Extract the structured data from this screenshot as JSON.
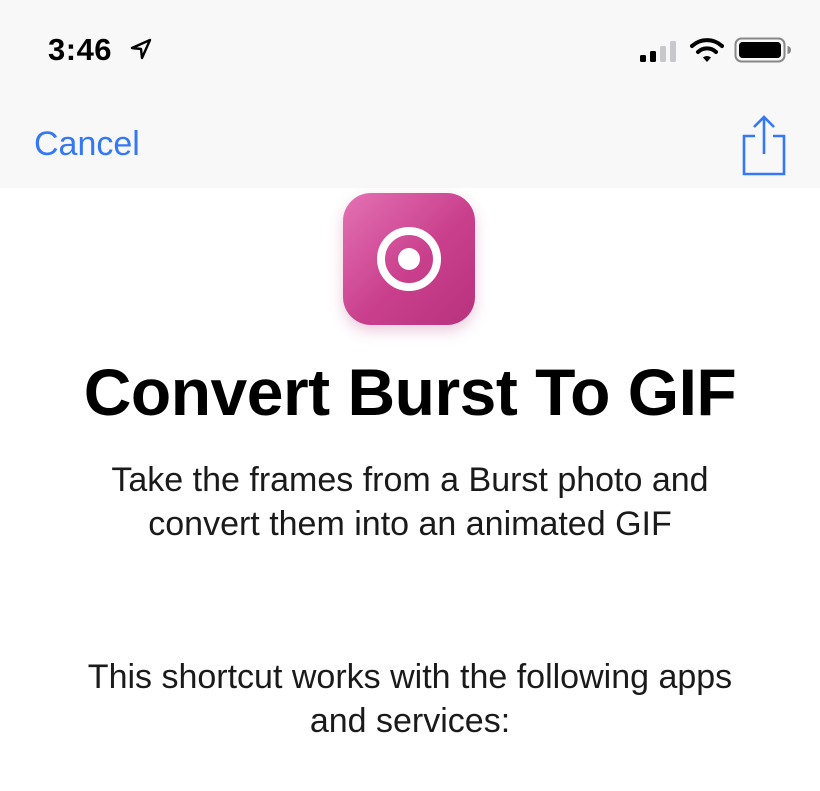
{
  "status_bar": {
    "time": "3:46",
    "icons": [
      "location-arrow-icon",
      "cellular-signal-icon",
      "wifi-icon",
      "battery-icon"
    ]
  },
  "nav": {
    "cancel_label": "Cancel",
    "share_icon": "share-icon"
  },
  "shortcut": {
    "icon": "target-icon",
    "icon_colors": [
      "#e472b4",
      "#b8327e"
    ],
    "title": "Convert Burst To GIF",
    "description": "Take the frames from a Burst photo and convert them into an animated GIF",
    "compatibility_text": "This shortcut works with the following apps and services:"
  },
  "colors": {
    "accent": "#3478f6",
    "header_background": "#f8f8f8"
  }
}
